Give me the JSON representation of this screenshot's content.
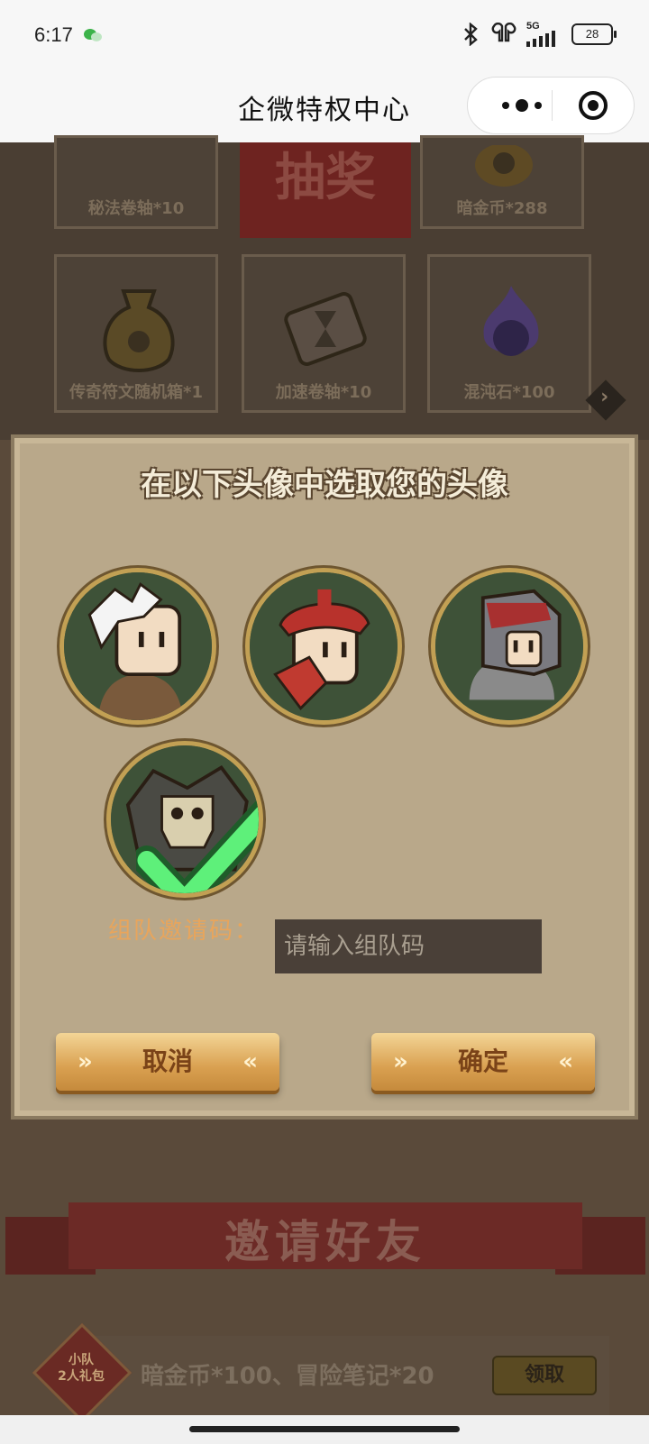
{
  "status_bar": {
    "time": "6:17",
    "network": "5G",
    "battery": "28"
  },
  "header": {
    "title": "企微特权中心"
  },
  "prizes": {
    "row1": [
      "秘法卷轴*10",
      "抽奖",
      "暗金币*288"
    ],
    "row2": [
      "传奇符文随机箱*1",
      "加速卷轴*10",
      "混沌石*100"
    ]
  },
  "modal": {
    "title": "在以下头像中选取您的头像",
    "avatars": [
      "white-hair-warrior",
      "red-hat-hero",
      "horned-knight",
      "skull-orc"
    ],
    "selected_index": 3,
    "invite_label": "组队邀请码：",
    "invite_placeholder": "请输入组队码",
    "cancel_label": "取消",
    "confirm_label": "确定",
    "chevron_left": "»",
    "chevron_right": "«"
  },
  "invite_section": {
    "banner": "邀请好友",
    "badge_line1": "小队",
    "badge_line2": "2人礼包",
    "reward": "暗金币*100、冒险笔记*20",
    "claim_label": "领取"
  },
  "colors": {
    "modal_bg": "#b9a88a",
    "button_gold": "#d9a050",
    "invite_label": "#e8a55c"
  }
}
